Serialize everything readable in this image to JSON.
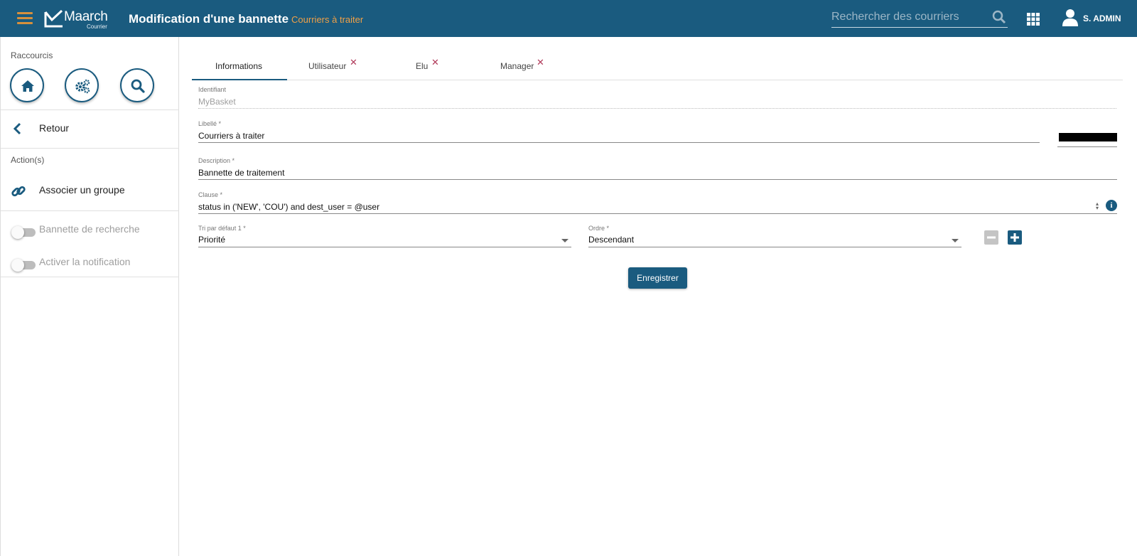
{
  "header": {
    "logo_name": "Maarch",
    "logo_sub": "Courrier",
    "title": "Modification d'une bannette",
    "subtitle": "Courriers à traiter",
    "search_placeholder": "Rechercher des courriers",
    "user_name": "S. ADMIN",
    "bar_color": "#1a5b7f",
    "accent_color": "#d7903c"
  },
  "sidebar": {
    "shortcuts_label": "Raccourcis",
    "shortcuts": [
      {
        "name": "home-icon"
      },
      {
        "name": "gears-icon"
      },
      {
        "name": "search-icon"
      }
    ],
    "back_label": "Retour",
    "actions_label": "Action(s)",
    "associate_group_label": "Associer un groupe",
    "toggles": [
      {
        "label": "Bannette de recherche",
        "checked": false
      },
      {
        "label": "Activer la notification",
        "checked": false
      }
    ]
  },
  "tabs": [
    {
      "label": "Informations",
      "closable": false,
      "active": true
    },
    {
      "label": "Utilisateur",
      "closable": true,
      "active": false
    },
    {
      "label": "Elu",
      "closable": true,
      "active": false
    },
    {
      "label": "Manager",
      "closable": true,
      "active": false
    }
  ],
  "form": {
    "identifier_label": "Identifiant",
    "identifier_value": "MyBasket",
    "libelle_label": "Libellé *",
    "libelle_value": "Courriers à traiter",
    "color_value": "#000000",
    "description_label": "Description *",
    "description_value": "Bannette de traitement",
    "clause_label": "Clause *",
    "clause_value": "status in ('NEW', 'COU') and dest_user = @user",
    "sort_label": "Tri par défaut 1 *",
    "sort_value": "Priorité",
    "order_label": "Ordre *",
    "order_value": "Descendant",
    "save_label": "Enregistrer"
  }
}
